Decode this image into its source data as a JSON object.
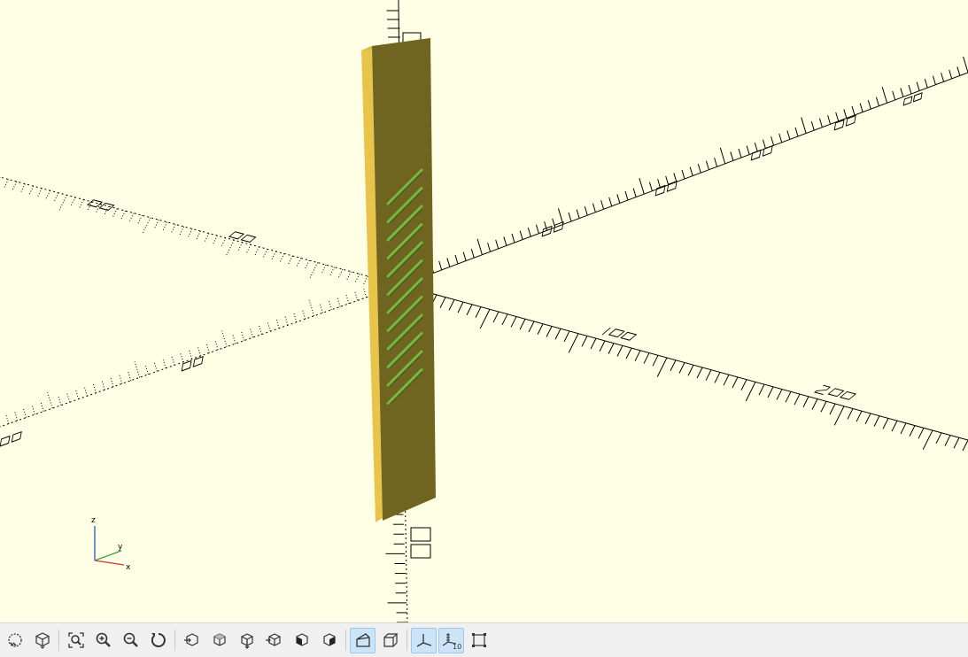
{
  "viewport": {
    "background": "#ffffe5",
    "model_face_color": "#6f6420",
    "model_edge_color": "#e8c54a",
    "slot_color": "#74b840"
  },
  "axes_indicator": {
    "x_label": "x",
    "y_label": "y",
    "z_label": "z"
  },
  "toolbar": {
    "buttons": [
      {
        "name": "preview-button",
        "icon": "preview-icon",
        "active": false
      },
      {
        "name": "render-button",
        "icon": "render-icon",
        "active": false
      },
      {
        "name": "view-all-button",
        "icon": "zoom-fit-icon",
        "active": false
      },
      {
        "name": "zoom-in-button",
        "icon": "zoom-in-icon",
        "active": false
      },
      {
        "name": "zoom-out-button",
        "icon": "zoom-out-icon",
        "active": false
      },
      {
        "name": "reset-view-button",
        "icon": "reset-view-icon",
        "active": false
      },
      {
        "name": "view-right-button",
        "icon": "view-right-icon",
        "active": false
      },
      {
        "name": "view-top-button",
        "icon": "view-top-icon",
        "active": false
      },
      {
        "name": "view-bottom-button",
        "icon": "view-bottom-icon",
        "active": false
      },
      {
        "name": "view-left-button",
        "icon": "view-left-icon",
        "active": false
      },
      {
        "name": "view-front-button",
        "icon": "view-front-icon",
        "active": false
      },
      {
        "name": "view-back-button",
        "icon": "view-back-icon",
        "active": false
      },
      {
        "name": "perspective-button",
        "icon": "perspective-icon",
        "active": true
      },
      {
        "name": "orthogonal-button",
        "icon": "orthogonal-icon",
        "active": false
      },
      {
        "name": "show-axes-button",
        "icon": "axes-icon",
        "active": true
      },
      {
        "name": "show-scale-markers-button",
        "icon": "scale-markers-icon",
        "active": true,
        "label": "10"
      },
      {
        "name": "show-edges-button",
        "icon": "edges-icon",
        "active": false
      }
    ]
  }
}
